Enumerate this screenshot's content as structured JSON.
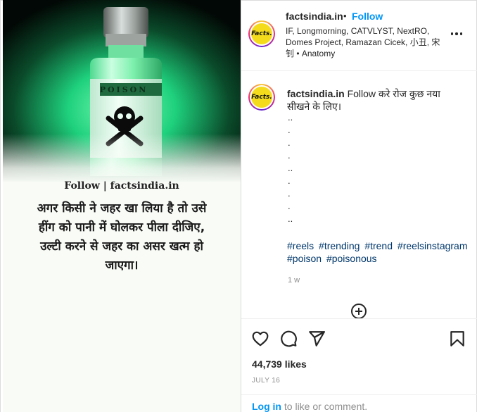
{
  "post": {
    "image": {
      "label_text": "POISON",
      "overlay_follow": "Follow | factsindia.in",
      "overlay_hindi": "अगर किसी ने जहर खा लिया है तो उसे हींग को पानी में घोलकर पीला दीजिए, उल्टी करने से जहर का असर खत्म हो जाएगा।"
    },
    "header": {
      "username": "factsindia.in",
      "dot": "•",
      "follow_label": "Follow",
      "audio": "IF, Longmorning, CATVLYST, NextRO, Domes Project, Ramazan Cicek, 小丑, 宋钊 • Anatomy",
      "avatar_text": "Facts."
    },
    "caption": {
      "username": "factsindia.in",
      "text": "Follow करे रोज कुछ नया सीखने के लिए।",
      "dots": [
        "..",
        ".",
        ".",
        ".",
        "..",
        ".",
        ".",
        ".",
        ".."
      ],
      "hashtags": [
        "#reels",
        "#trending",
        "#trend",
        "#reelsinstagram",
        "#poison",
        "#poisonous"
      ],
      "time_ago": "1 w"
    },
    "actions": {
      "like_icon": "heart-icon",
      "comment_icon": "comment-icon",
      "share_icon": "share-icon",
      "save_icon": "bookmark-icon",
      "add_comment_icon": "plus-circle-icon"
    },
    "likes": "44,739 likes",
    "date": "JULY 16",
    "login": {
      "link": "Log in",
      "rest": " to like or comment."
    },
    "colors": {
      "accent": "#0095f6",
      "hashtag": "#00376b",
      "muted": "#8e8e8e"
    }
  }
}
